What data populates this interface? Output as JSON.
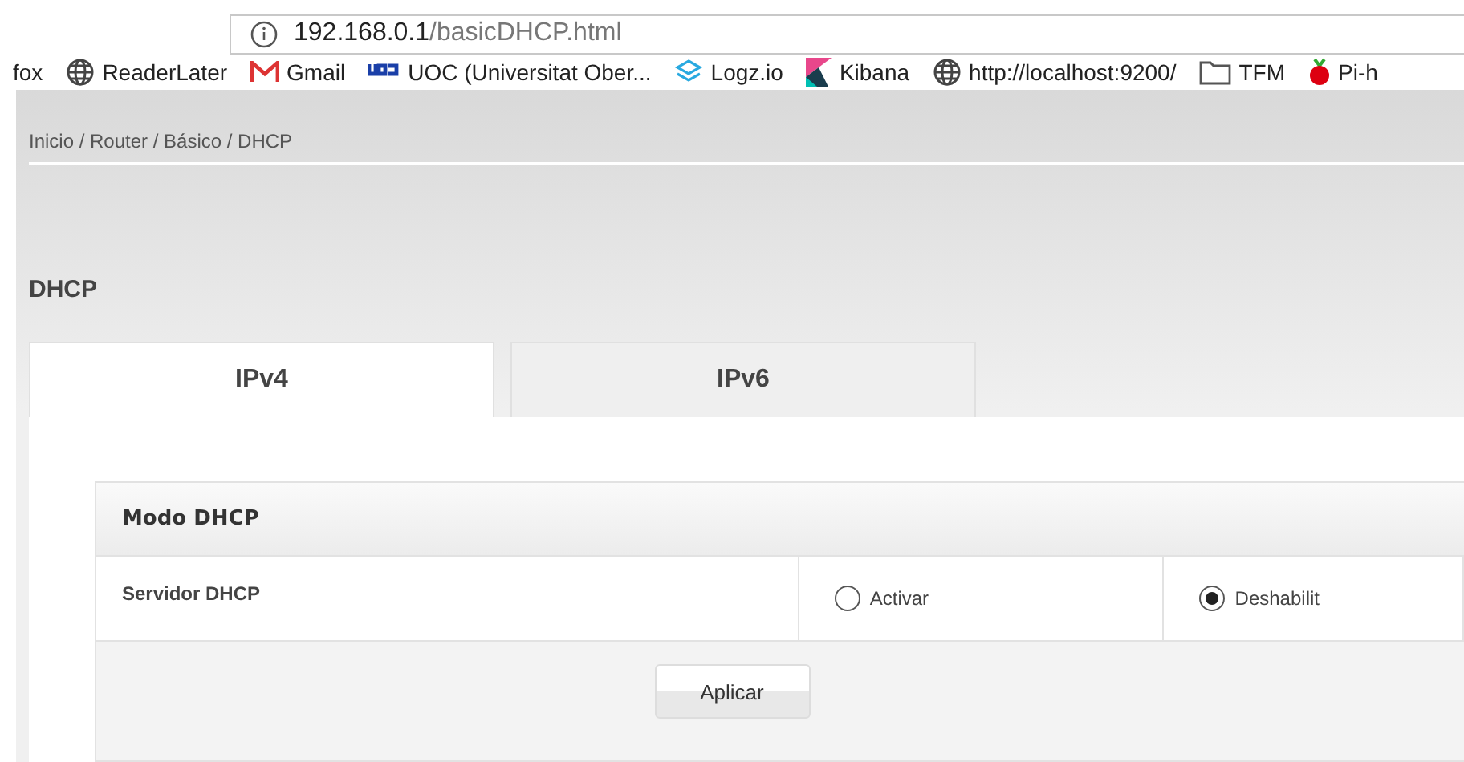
{
  "address_bar": {
    "host": "192.168.0.1",
    "path": "/basicDHCP.html"
  },
  "bookmarks": [
    {
      "label": "fox",
      "kind": "none"
    },
    {
      "label": "ReaderLater",
      "kind": "globe"
    },
    {
      "label": "Gmail",
      "kind": "mail"
    },
    {
      "label": "UOC (Universitat Ober...",
      "kind": "uoc"
    },
    {
      "label": "Logz.io",
      "kind": "logz"
    },
    {
      "label": "Kibana",
      "kind": "kibana"
    },
    {
      "label": "http://localhost:9200/",
      "kind": "globe"
    },
    {
      "label": "TFM",
      "kind": "folder"
    },
    {
      "label": "Pi-h",
      "kind": "berry"
    }
  ],
  "breadcrumb": "Inicio / Router / Básico / DHCP",
  "page_title": "DHCP",
  "tabs": [
    {
      "label": "IPv4",
      "selected": true
    },
    {
      "label": "IPv6",
      "selected": false
    }
  ],
  "section": {
    "title": "Modo DHCP",
    "row_label": "Servidor DHCP",
    "options": [
      {
        "label": "Activar",
        "selected": false
      },
      {
        "label": "Deshabilit",
        "selected": true
      }
    ],
    "button": "Aplicar"
  }
}
